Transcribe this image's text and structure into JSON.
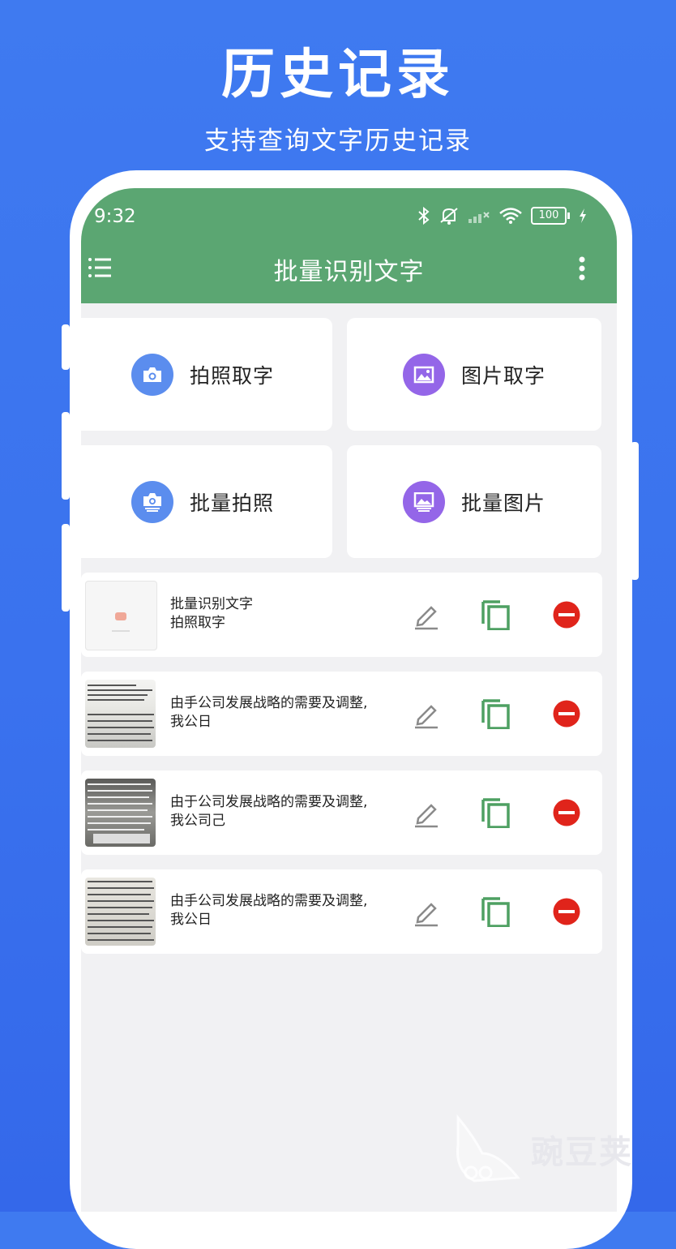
{
  "promo": {
    "title": "历史记录",
    "subtitle": "支持查询文字历史记录"
  },
  "status_bar": {
    "time": "9:32",
    "battery": "100",
    "icons": [
      "bluetooth-icon",
      "mute-icon",
      "signal-icon",
      "wifi-icon",
      "battery-icon",
      "charging-icon"
    ]
  },
  "appbar": {
    "title": "批量识别文字",
    "menu_icon": "menu-icon",
    "more_icon": "more-vert-icon",
    "color": "#5ba672"
  },
  "actions": [
    {
      "label": "拍照取字",
      "icon": "camera-icon",
      "color": "#5b8dee"
    },
    {
      "label": "图片取字",
      "icon": "image-icon",
      "color": "#9466e8"
    },
    {
      "label": "批量拍照",
      "icon": "batch-camera-icon",
      "color": "#5b8dee"
    },
    {
      "label": "批量图片",
      "icon": "batch-image-icon",
      "color": "#9466e8"
    }
  ],
  "history": [
    {
      "line1": "批量识别文字",
      "line2": "拍照取字"
    },
    {
      "line1": "由手公司发展战略的需要及调整,",
      "line2": "我公日"
    },
    {
      "line1": "由于公司发展战略的需要及调整,",
      "line2": "我公司己"
    },
    {
      "line1": "由手公司发展战略的需要及调整,",
      "line2": "我公日"
    }
  ],
  "row_actions": {
    "edit_icon": "edit-icon",
    "copy_icon": "copy-icon",
    "delete_icon": "delete-icon",
    "delete_color": "#e0241b",
    "copy_color": "#4ea062"
  },
  "watermark": {
    "text": "豌豆荚"
  }
}
